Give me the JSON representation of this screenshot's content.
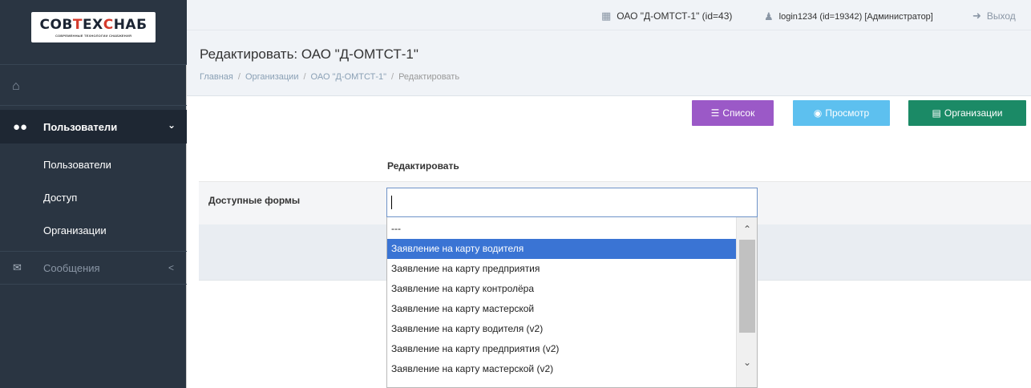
{
  "sidebar": {
    "logo_main_1": "СОВ",
    "logo_main_2": "Т",
    "logo_main_3": "ЕХ",
    "logo_main_4": "С",
    "logo_main_5": "НАБ",
    "logo_sub": "СОВРЕМЕННЫЕ ТЕХНОЛОГИИ СНАБЖЕНИЯ",
    "home_icon": "home-icon",
    "users_menu": "Пользователи",
    "submenu": [
      "Пользователи",
      "Доступ",
      "Организации"
    ],
    "messages_menu": "Сообщения"
  },
  "topbar": {
    "org": "ОАО \"Д-ОМТСТ-1\" (id=43)",
    "user": "login1234 (id=19342) [Администратор]",
    "exit": "Выход"
  },
  "header": {
    "title": "Редактировать: ОАО \"Д-ОМТСТ-1\"",
    "breadcrumb": [
      "Главная",
      "Организации",
      "ОАО \"Д-ОМТСТ-1\"",
      "Редактировать"
    ]
  },
  "buttons": {
    "list": "Список",
    "view": "Просмотр",
    "orgs": "Организации"
  },
  "form": {
    "caption": "Редактировать",
    "label": "Доступные формы",
    "input_value": ""
  },
  "dropdown": {
    "options": [
      "---",
      "Заявление на карту водителя",
      "Заявление на карту предприятия",
      "Заявление на карту контролёра",
      "Заявление на карту мастерской",
      "Заявление на карту водителя (v2)",
      "Заявление на карту предприятия (v2)",
      "Заявление на карту мастерской (v2)"
    ],
    "selected": "Заявление на карту водителя"
  },
  "colors": {
    "sidebar": "#2a3542",
    "btn_list": "#9b59c7",
    "btn_view": "#5dc0ef",
    "btn_org": "#1b8a66",
    "selected_option": "#3a74d4"
  }
}
